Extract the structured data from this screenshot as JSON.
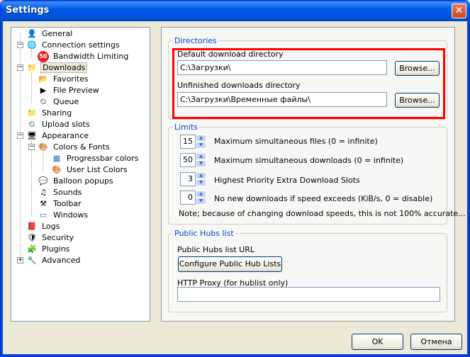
{
  "window": {
    "title": "Settings",
    "close_glyph": "✕"
  },
  "tree": {
    "items": [
      {
        "label": "General",
        "icon": "user-icon"
      },
      {
        "label": "Connection settings",
        "icon": "globe-icon"
      },
      {
        "label": "Bandwidth Limiting",
        "icon": "speed-limit-icon",
        "icon_text": "50"
      },
      {
        "label": "Downloads",
        "icon": "download-folder-icon"
      },
      {
        "label": "Favorites",
        "icon": "favorites-folder-icon"
      },
      {
        "label": "File Preview",
        "icon": "preview-icon"
      },
      {
        "label": "Queue",
        "icon": "queue-icon"
      },
      {
        "label": "Sharing",
        "icon": "sharing-icon"
      },
      {
        "label": "Upload slots",
        "icon": "upload-slots-icon"
      },
      {
        "label": "Appearance",
        "icon": "appearance-icon"
      },
      {
        "label": "Colors & Fonts",
        "icon": "palette-icon"
      },
      {
        "label": "Progressbar colors",
        "icon": "progressbar-icon"
      },
      {
        "label": "User List Colors",
        "icon": "user-list-colors-icon"
      },
      {
        "label": "Balloon popups",
        "icon": "balloon-icon"
      },
      {
        "label": "Sounds",
        "icon": "sounds-icon"
      },
      {
        "label": "Toolbar",
        "icon": "toolbar-icon"
      },
      {
        "label": "Windows",
        "icon": "windows-icon"
      },
      {
        "label": "Logs",
        "icon": "logs-icon"
      },
      {
        "label": "Security",
        "icon": "shield-icon"
      },
      {
        "label": "Plugins",
        "icon": "puzzle-icon"
      },
      {
        "label": "Advanced",
        "icon": "advanced-icon"
      }
    ],
    "minus": "−",
    "plus": "+"
  },
  "directories": {
    "legend": "Directories",
    "default_label": "Default download directory",
    "default_value": "C:\\Загрузки\\",
    "unfinished_label": "Unfinished downloads directory",
    "unfinished_value": "C:\\Загрузки\\Временные файлы\\",
    "browse_label": "Browse..."
  },
  "limits": {
    "legend": "Limits",
    "rows": [
      {
        "value": "15",
        "label": "Maximum simultaneous files (0 = infinite)"
      },
      {
        "value": "50",
        "label": "Maximum simultaneous downloads (0 = infinite)"
      },
      {
        "value": "3",
        "label": "Highest Priority Extra Download Slots"
      },
      {
        "value": "0",
        "label": "No new downloads if speed exceeds (KiB/s, 0 = disable)"
      }
    ],
    "note": "Note; because of changing download speeds, this is not 100% accurate...",
    "up": "▲",
    "down": "▼"
  },
  "hubs": {
    "legend": "Public Hubs list",
    "url_label": "Public Hubs list URL",
    "configure_label": "Configure Public Hub Lists",
    "proxy_label": "HTTP Proxy (for hublist only)",
    "proxy_value": ""
  },
  "footer": {
    "ok_label": "OK",
    "cancel_label": "Отмена"
  },
  "colors": {
    "highlight": "#ff0000",
    "title_bar": "#0058e6",
    "group_legend": "#0046d5"
  }
}
